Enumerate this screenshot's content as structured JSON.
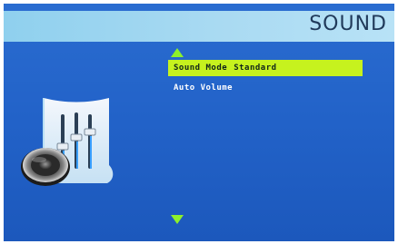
{
  "header": {
    "title": "SOUND"
  },
  "menu": {
    "items": [
      {
        "label": "Sound Mode",
        "value": "Standard"
      },
      {
        "label": "Auto Volume",
        "value": ""
      }
    ]
  },
  "icons": {
    "scroll_up": "triangle-up-icon",
    "scroll_down": "triangle-down-icon",
    "sound_settings": "equalizer-speaker-icon"
  },
  "colors": {
    "background": "#2262c8",
    "header_band": "#a9daf2",
    "highlight": "#c6f21e",
    "arrow": "#8ef02a",
    "text": "#ffffff"
  }
}
